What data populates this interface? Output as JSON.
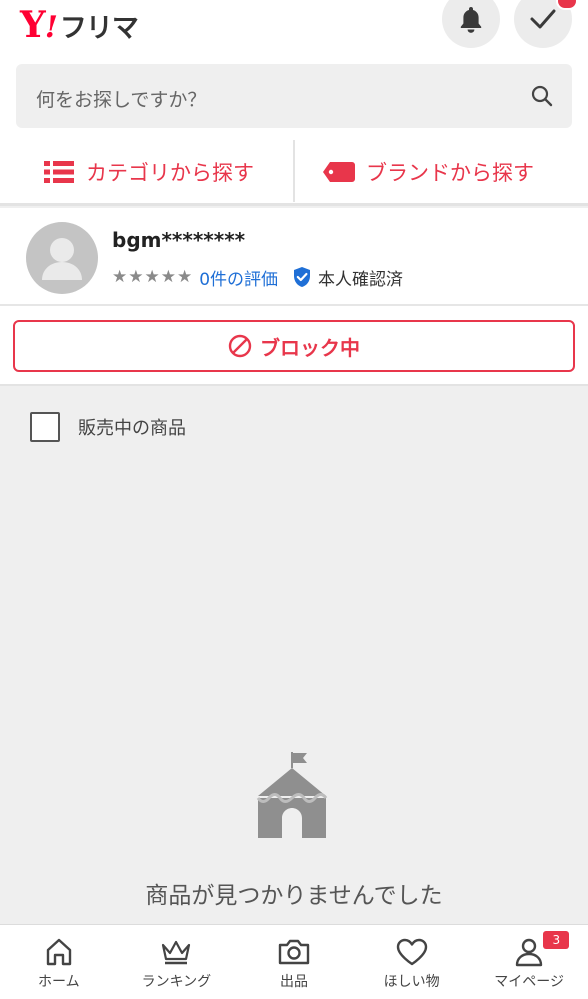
{
  "header": {
    "logo_y": "Y",
    "logo_bang": "!",
    "logo_text": "フリマ",
    "bell_icon": "bell-icon",
    "check_icon": "check-icon"
  },
  "search": {
    "placeholder": "何をお探しですか？",
    "icon": "search-icon"
  },
  "browse": {
    "category_label": "カテゴリから探す",
    "brand_label": "ブランドから探す",
    "accent_color": "#e8364b"
  },
  "profile": {
    "username": "bgm********",
    "stars": "★★★★★",
    "evaluation_count": "0件の評価",
    "verified": "本人確認済"
  },
  "block_button": {
    "label": "ブロック中"
  },
  "filter": {
    "label": "販売中の商品",
    "checked": false
  },
  "empty_state": {
    "message": "商品が見つかりませんでした",
    "icon": "tent-icon"
  },
  "tabbar": {
    "items": [
      {
        "label": "ホーム",
        "icon": "home-icon"
      },
      {
        "label": "ランキング",
        "icon": "crown-icon"
      },
      {
        "label": "出品",
        "icon": "camera-icon"
      },
      {
        "label": "ほしい物",
        "icon": "heart-icon"
      },
      {
        "label": "マイページ",
        "icon": "person-icon",
        "badge": "3"
      }
    ]
  }
}
